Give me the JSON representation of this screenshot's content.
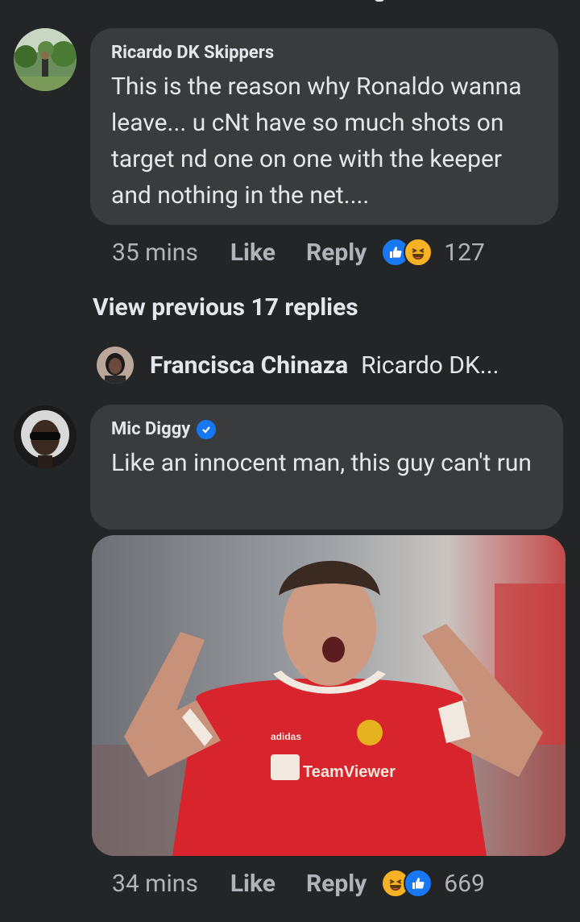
{
  "comments": [
    {
      "author": "Ricardo DK Skippers",
      "text": "This is the reason why Ronaldo wanna leave... u cNt have so much shots on target nd one on one with the keeper and nothing in the net....",
      "time": "35 mins",
      "like_label": "Like",
      "reply_label": "Reply",
      "reactions": [
        "like",
        "haha"
      ],
      "reaction_count": "127"
    },
    {
      "author": "Mic Diggy",
      "verified": true,
      "text": "Like an innocent man, this guy can't run",
      "time": "34 mins",
      "like_label": "Like",
      "reply_label": "Reply",
      "reactions": [
        "haha",
        "like"
      ],
      "reaction_count": "669",
      "photo_jersey": [
        "adidas",
        "TeamViewer"
      ]
    }
  ],
  "view_previous": "View previous 17 replies",
  "reply_preview": {
    "author": "Francisca Chinaza",
    "text": "Ricardo DK..."
  },
  "colors": {
    "background": "#242526",
    "bubble": "#3a3b3c",
    "like_blue": "#1877f2",
    "haha_yellow": "#f7b125"
  }
}
